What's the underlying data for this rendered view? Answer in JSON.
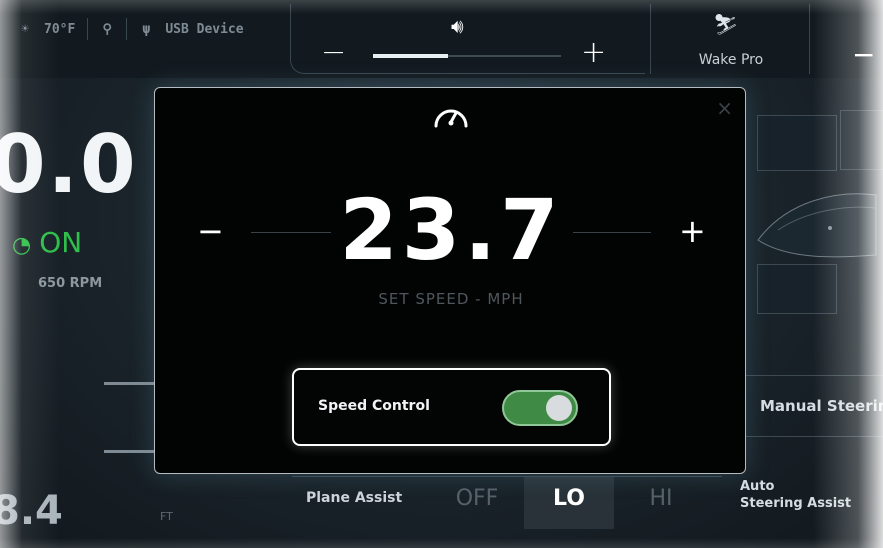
{
  "status_bar": {
    "temperature": "70°F",
    "usb_label": "USB Device"
  },
  "volume": {
    "minus": "−",
    "plus": "+",
    "level_fraction": 0.4
  },
  "wake": {
    "label": "Wake Pro"
  },
  "right_partial_minus": "−",
  "dashboard": {
    "speed_partial": "0.0",
    "cruise_status": "ON",
    "rpm_partial": "650 RPM",
    "depth_partial": "8.4",
    "depth_unit": "FT",
    "manual_steering_partial": "Manual Steering",
    "auto_steering_line1": "Auto",
    "auto_steering_line2": "Steering Assist",
    "plane_assist": {
      "label": "Plane Assist",
      "options": [
        "OFF",
        "LO",
        "HI"
      ],
      "selected": "LO"
    }
  },
  "modal": {
    "close": "×",
    "decrement": "−",
    "increment": "+",
    "set_speed_value": "23.7",
    "set_speed_label": "SET SPEED - MPH",
    "speed_control": {
      "label": "Speed Control",
      "enabled": true
    }
  },
  "colors": {
    "accent_green": "#3f8a45",
    "cruise_green": "#2fbf4a",
    "modal_bg": "#020303"
  }
}
